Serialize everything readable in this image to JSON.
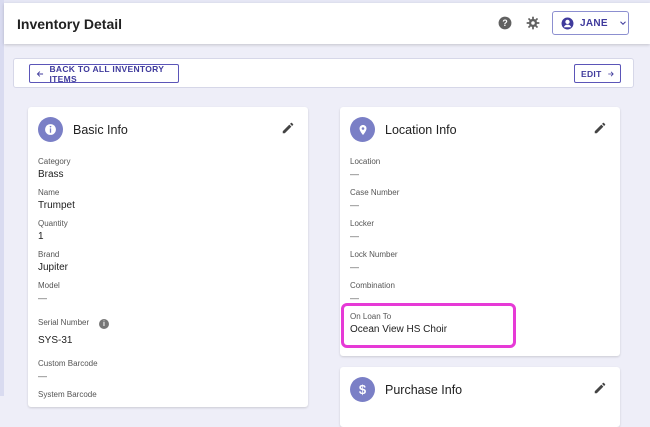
{
  "app_bar": {
    "title": "Inventory Detail",
    "help_icon": "help-circle-icon",
    "settings_icon": "gear-icon",
    "user": {
      "name": "JANE",
      "icon": "account-circle-icon",
      "chevron": "chevron-down-icon"
    }
  },
  "toolbar": {
    "back_label": "BACK TO ALL INVENTORY ITEMS",
    "edit_label": "EDIT"
  },
  "basic_info": {
    "title": "Basic Info",
    "icon": "info-icon",
    "fields": [
      {
        "label": "Category",
        "value": "Brass"
      },
      {
        "label": "Name",
        "value": "Trumpet"
      },
      {
        "label": "Quantity",
        "value": "1"
      },
      {
        "label": "Brand",
        "value": "Jupiter"
      },
      {
        "label": "Model",
        "value": "—"
      },
      {
        "label": "Serial Number",
        "value": "SYS-31"
      },
      {
        "label": "Custom Barcode",
        "value": "—"
      },
      {
        "label": "System Barcode",
        "value": ""
      }
    ],
    "serial_info_glyph": "i"
  },
  "location_info": {
    "title": "Location Info",
    "icon": "location-pin-icon",
    "fields": [
      {
        "label": "Location",
        "value": "—"
      },
      {
        "label": "Case Number",
        "value": "—"
      },
      {
        "label": "Locker",
        "value": "—"
      },
      {
        "label": "Lock Number",
        "value": "—"
      },
      {
        "label": "Combination",
        "value": "—"
      },
      {
        "label": "On Loan To",
        "value": "Ocean View HS Choir"
      }
    ]
  },
  "purchase_info": {
    "title": "Purchase Info",
    "icon": "dollar-icon"
  },
  "colors": {
    "accent": "#3f3a9c",
    "avatar": "#7a7fc6",
    "highlight": "#e63ad6"
  }
}
